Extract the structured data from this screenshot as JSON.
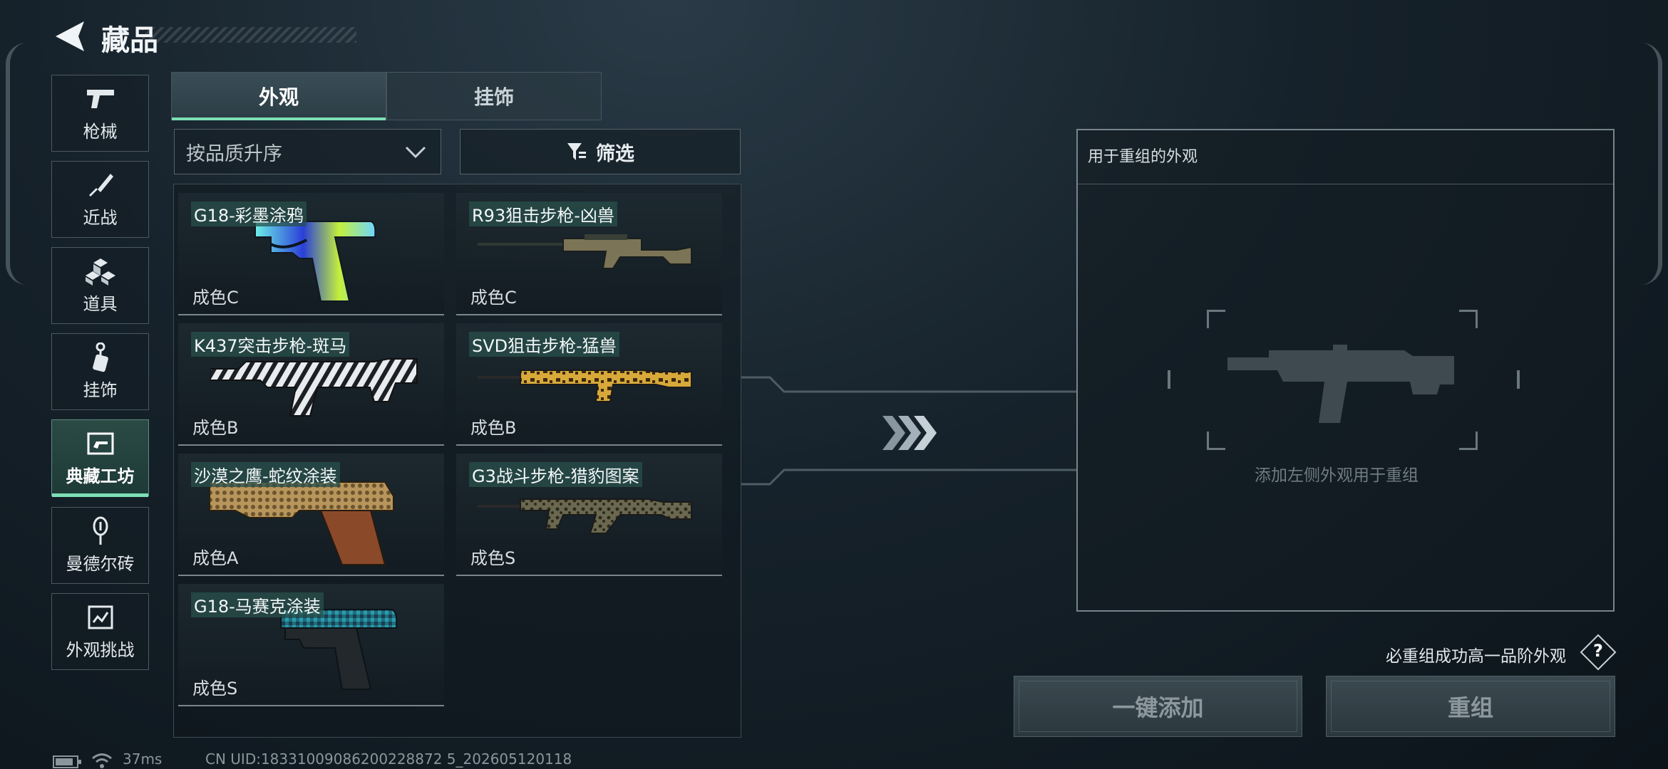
{
  "header": {
    "title": "藏品",
    "back_icon": "back-arrow-icon"
  },
  "sidebar": {
    "items": [
      {
        "label": "枪械",
        "icon": "pistol-icon",
        "active": false
      },
      {
        "label": "近战",
        "icon": "knife-icon",
        "active": false
      },
      {
        "label": "道具",
        "icon": "cubes-icon",
        "active": false
      },
      {
        "label": "挂饰",
        "icon": "charm-icon",
        "active": false
      },
      {
        "label": "典藏工坊",
        "icon": "workshop-icon",
        "active": true
      },
      {
        "label": "曼德尔砖",
        "icon": "key-icon",
        "active": false
      },
      {
        "label": "外观挑战",
        "icon": "challenge-icon",
        "active": false
      }
    ]
  },
  "tabs": [
    {
      "label": "外观",
      "active": true
    },
    {
      "label": "挂饰",
      "active": false
    }
  ],
  "sort": {
    "value": "按品质升序"
  },
  "filter": {
    "label": "筛选"
  },
  "items": [
    {
      "name": "G18-彩墨涂鸦",
      "grade": "成色C"
    },
    {
      "name": "R93狙击步枪-凶兽",
      "grade": "成色C"
    },
    {
      "name": "K437突击步枪-斑马",
      "grade": "成色B"
    },
    {
      "name": "SVD狙击步枪-猛兽",
      "grade": "成色B"
    },
    {
      "name": "沙漠之鹰-蛇纹涂装",
      "grade": "成色A"
    },
    {
      "name": "G3战斗步枪-猎豹图案",
      "grade": "成色S"
    },
    {
      "name": "G18-马赛克涂装",
      "grade": "成色S"
    }
  ],
  "panel": {
    "title": "用于重组的外观",
    "placeholder": "添加左侧外观用于重组"
  },
  "hint": {
    "text": "必重组成功高一品阶外观",
    "icon": "?"
  },
  "buttons": {
    "add_all": "一键添加",
    "recombine": "重组"
  },
  "status": {
    "ping": "37ms",
    "uid": "CN UID:18331009086200228872 5_202605120118"
  },
  "colors": {
    "accent": "#7de0b5",
    "active_nav": "#1d3a37"
  }
}
